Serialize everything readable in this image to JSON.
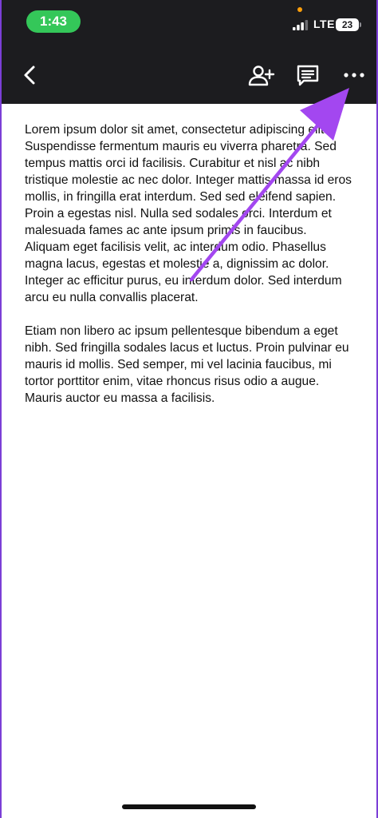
{
  "status_bar": {
    "time": "1:43",
    "network": "LTE",
    "battery": "23"
  },
  "toolbar": {
    "back_icon": "chevron-left-icon",
    "share_icon": "add-person-icon",
    "comment_icon": "comment-icon",
    "more_icon": "more-horizontal-icon"
  },
  "document": {
    "paragraphs": [
      "Lorem ipsum dolor sit amet, consectetur adipiscing elit. Suspendisse fermentum mauris eu viverra pharetra. Sed tempus mattis orci id facilisis. Curabitur et nisl ac nibh tristique molestie ac nec dolor. Integer mattis massa id eros mollis, in fringilla erat interdum. Sed sed eleifend sapien. Proin a egestas nisl. Nulla sed sodales orci. Interdum et malesuada fames ac ante ipsum primis in faucibus. Aliquam eget facilisis velit, ac interdum odio. Phasellus magna lacus, egestas et molestie a, dignissim ac dolor. Integer ac efficitur purus, eu interdum dolor. Sed interdum arcu eu nulla convallis placerat.",
      "Etiam non libero ac ipsum pellentesque bibendum a eget nibh. Sed fringilla sodales lacus et luctus. Proin pulvinar eu mauris id mollis. Sed semper, mi vel lacinia faucibus, mi tortor porttitor enim, vitae rhoncus risus odio a augue. Mauris auctor eu massa a facilisis."
    ]
  },
  "annotation": {
    "arrow_color": "#a347f0"
  },
  "colors": {
    "toolbar_bg": "#1c1c1f",
    "time_pill": "#34c759",
    "frame_border": "#7b3fd6"
  }
}
